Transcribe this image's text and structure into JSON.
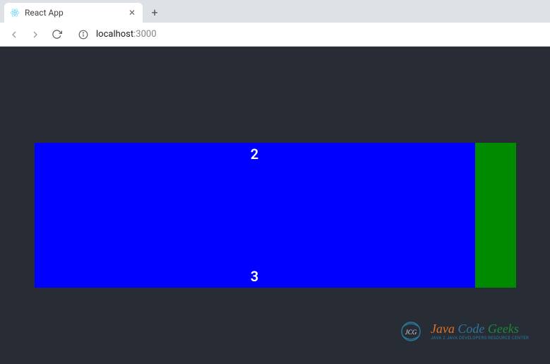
{
  "browser": {
    "tab_title": "React App",
    "url_host": "localhost",
    "url_port": ":3000"
  },
  "app": {
    "numbers": {
      "top": "2",
      "bottom": "3"
    },
    "colors": {
      "background": "#282c34",
      "box_blue": "#0000ff",
      "box_green": "#008a00"
    }
  },
  "watermark": {
    "word1": "Java",
    "word2": "Code",
    "word3": "Geeks",
    "tagline": "Java 2 Java Developers Resource Center",
    "badge": "JCG"
  }
}
